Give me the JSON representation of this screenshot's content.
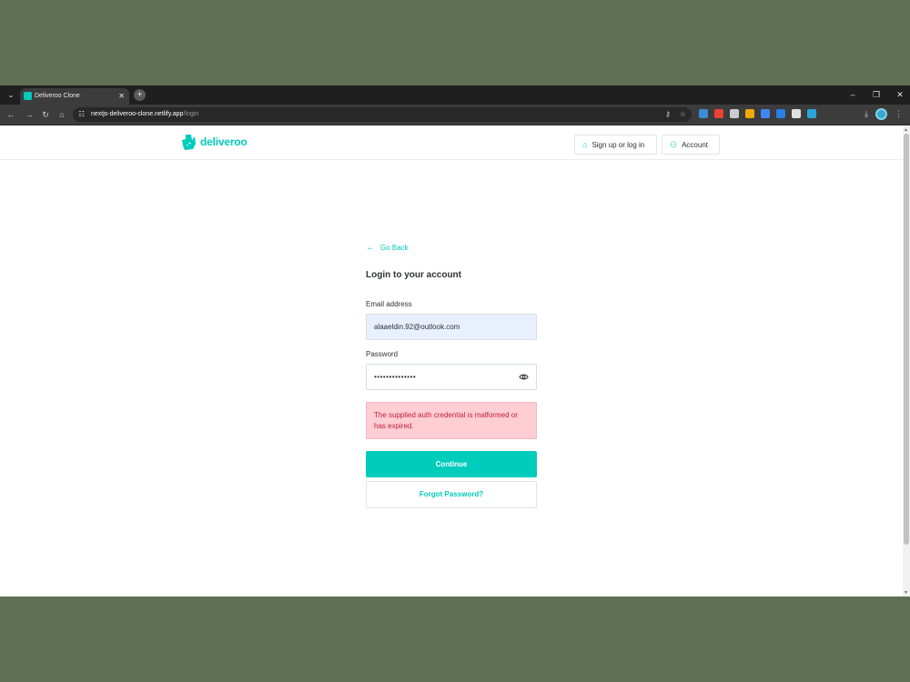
{
  "browser": {
    "tab_title": "Deliveroo Clone",
    "url_host": "nextjs-deliveroo-clone.netlify.app",
    "url_path": "/login",
    "extensions": [
      "#3c8dd9",
      "#ea4335",
      "#cccccc",
      "#f2a900",
      "#4285f4",
      "#2b7de9",
      "#e0e0e0",
      "#2aa4d8"
    ]
  },
  "header": {
    "logo_text": "deliveroo",
    "signup_label": "Sign up or log in",
    "account_label": "Account"
  },
  "login": {
    "go_back": "Go Back",
    "title": "Login to your account",
    "email_label": "Email address",
    "email_value": "alaaeldin.92@outlook.com",
    "password_label": "Password",
    "password_value": "••••••••••••••",
    "error_message": "The supplied auth credential is malformed or has expired.",
    "continue_label": "Continue",
    "forgot_label": "Forgot Password?"
  },
  "colors": {
    "brand": "#00ccbc",
    "error_bg": "#ffcdd4",
    "error_text": "#c0203a"
  }
}
